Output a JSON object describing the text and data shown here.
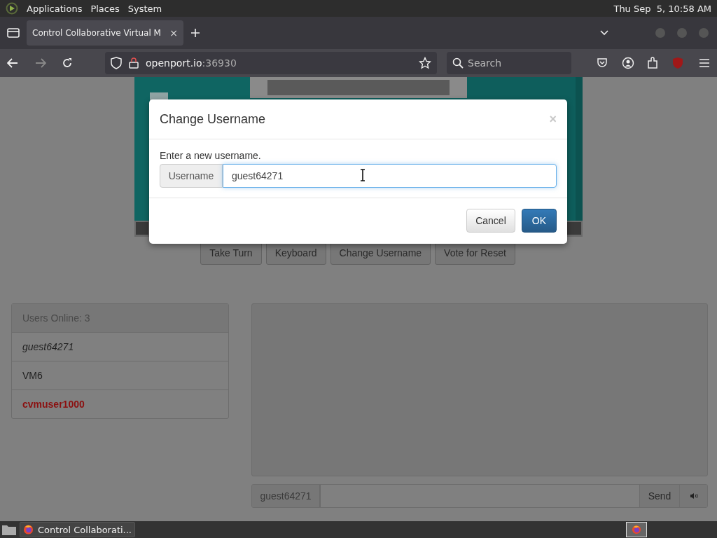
{
  "top_panel": {
    "menus": [
      "Applications",
      "Places",
      "System"
    ],
    "clock": "Thu Sep  5, 10:58 AM"
  },
  "browser": {
    "tab": {
      "title": "Control Collaborative Virtual M",
      "close": "×"
    },
    "url_host": "openport.io",
    "url_port": ":36930",
    "search": {
      "placeholder": "Search"
    }
  },
  "vm_controls": [
    "Take Turn",
    "Keyboard",
    "Change Username",
    "Vote for Reset"
  ],
  "users": {
    "header": "Users Online: 3",
    "items": [
      {
        "name": "guest64271",
        "kind": "self"
      },
      {
        "name": "VM6",
        "kind": "normal"
      },
      {
        "name": "cvmuser1000",
        "kind": "admin"
      }
    ]
  },
  "chat": {
    "username": "guest64271",
    "send": "Send"
  },
  "dialog": {
    "title": "Change Username",
    "close": "×",
    "prompt": "Enter a new username.",
    "field_label": "Username",
    "value": "guest64271",
    "buttons": [
      "Cancel",
      "OK"
    ]
  },
  "taskbar": {
    "window": "Control Collaborati..."
  }
}
